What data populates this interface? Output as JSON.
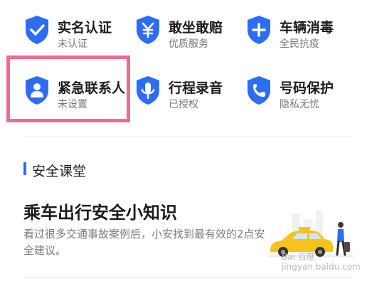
{
  "services": [
    {
      "title": "实名认证",
      "subtitle": "未认证",
      "icon": "check-shield-icon"
    },
    {
      "title": "敢坐敢赔",
      "subtitle": "优质服务",
      "icon": "yuan-shield-icon"
    },
    {
      "title": "车辆消毒",
      "subtitle": "全民抗疫",
      "icon": "plus-shield-icon"
    },
    {
      "title": "紧急联系人",
      "subtitle": "未设置",
      "icon": "person-shield-icon"
    },
    {
      "title": "行程录音",
      "subtitle": "已授权",
      "icon": "mic-shield-icon"
    },
    {
      "title": "号码保护",
      "subtitle": "隐私无忧",
      "icon": "phone-shield-icon"
    }
  ],
  "section": {
    "title": "安全课堂"
  },
  "article": {
    "title": "乘车出行安全小知识",
    "description": "看过很多交通事故案例后，小安找到最有效的2点安全建议。"
  },
  "watermark": {
    "line1": "Bai 百度",
    "line2": "jingyan.baidu.com"
  },
  "colors": {
    "shield": "#2d6df6",
    "highlight": "#f06b92",
    "taxi": "#f7c21b",
    "section_bar": "#2a6cf6"
  }
}
